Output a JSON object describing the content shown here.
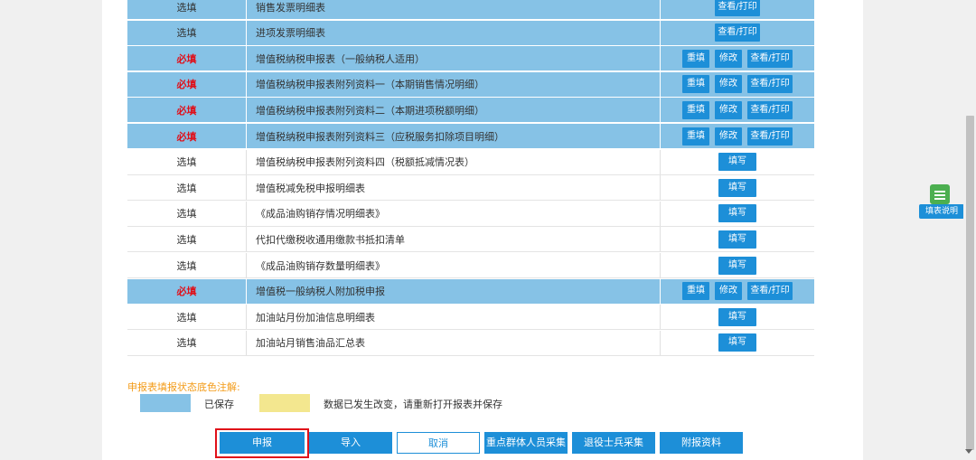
{
  "table": {
    "rows": [
      {
        "type": "选填",
        "required": false,
        "name": "销售发票明细表",
        "saved": true,
        "actions": [
          "查看/打印"
        ]
      },
      {
        "type": "选填",
        "required": false,
        "name": "进项发票明细表",
        "saved": true,
        "actions": [
          "查看/打印"
        ]
      },
      {
        "type": "必填",
        "required": true,
        "name": "增值税纳税申报表（一般纳税人适用）",
        "saved": true,
        "actions": [
          "重填",
          "修改",
          "查看/打印"
        ]
      },
      {
        "type": "必填",
        "required": true,
        "name": "增值税纳税申报表附列资料一（本期销售情况明细）",
        "saved": true,
        "actions": [
          "重填",
          "修改",
          "查看/打印"
        ]
      },
      {
        "type": "必填",
        "required": true,
        "name": "增值税纳税申报表附列资料二（本期进项税额明细）",
        "saved": true,
        "actions": [
          "重填",
          "修改",
          "查看/打印"
        ]
      },
      {
        "type": "必填",
        "required": true,
        "name": "增值税纳税申报表附列资料三（应税服务扣除项目明细）",
        "saved": true,
        "actions": [
          "重填",
          "修改",
          "查看/打印"
        ]
      },
      {
        "type": "选填",
        "required": false,
        "name": "增值税纳税申报表附列资料四（税额抵减情况表）",
        "saved": false,
        "actions": [
          "填写"
        ]
      },
      {
        "type": "选填",
        "required": false,
        "name": "增值税减免税申报明细表",
        "saved": false,
        "actions": [
          "填写"
        ]
      },
      {
        "type": "选填",
        "required": false,
        "name": "《成品油购销存情况明细表》",
        "saved": false,
        "actions": [
          "填写"
        ]
      },
      {
        "type": "选填",
        "required": false,
        "name": "代扣代缴税收通用缴款书抵扣清单",
        "saved": false,
        "actions": [
          "填写"
        ]
      },
      {
        "type": "选填",
        "required": false,
        "name": "《成品油购销存数量明细表》",
        "saved": false,
        "actions": [
          "填写"
        ]
      },
      {
        "type": "必填",
        "required": true,
        "name": "增值税一般纳税人附加税申报",
        "saved": true,
        "actions": [
          "重填",
          "修改",
          "查看/打印"
        ]
      },
      {
        "type": "选填",
        "required": false,
        "name": "加油站月份加油信息明细表",
        "saved": false,
        "actions": [
          "填写"
        ]
      },
      {
        "type": "选填",
        "required": false,
        "name": "加油站月销售油品汇总表",
        "saved": false,
        "actions": [
          "填写"
        ]
      }
    ]
  },
  "legend": {
    "title": "申报表填报状态底色注解:",
    "saved_label": "已保存",
    "changed_label": "数据已发生改变，请重新打开报表并保存",
    "saved_color": "#86c2e6",
    "changed_color": "#f3e78f"
  },
  "actions": {
    "declare": "申报",
    "import": "导入",
    "cancel": "取消",
    "key_groups": "重点群体人员采集",
    "veterans": "退役士兵采集",
    "attachments": "附报资料"
  },
  "help": {
    "label": "填表说明",
    "icon": "form-note-icon"
  },
  "colors": {
    "accent": "#1d8fd8",
    "required": "#e0101a",
    "legend_title": "#f39b17"
  }
}
